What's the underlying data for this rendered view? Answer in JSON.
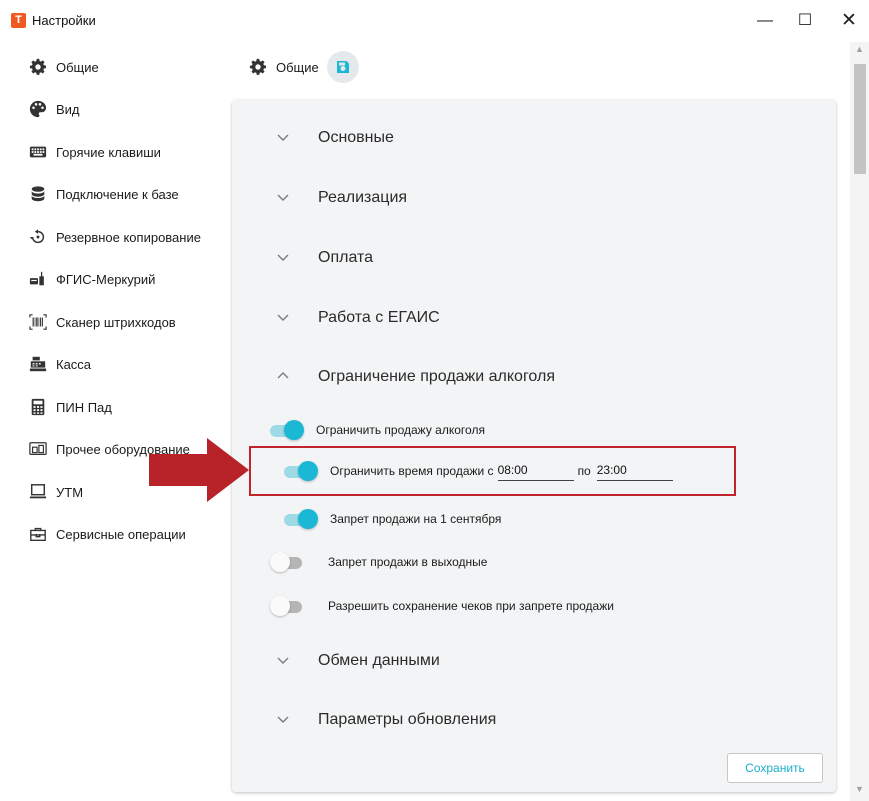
{
  "window": {
    "app_icon": "T",
    "title": "Настройки",
    "minimize": "—",
    "maximize": "☐",
    "close": "✕"
  },
  "sidebar": {
    "items": [
      {
        "label": "Общие",
        "icon": "gear-icon"
      },
      {
        "label": "Вид",
        "icon": "palette-icon"
      },
      {
        "label": "Горячие клавиши",
        "icon": "keyboard-icon"
      },
      {
        "label": "Подключение к базе",
        "icon": "database-icon"
      },
      {
        "label": "Резервное копирование",
        "icon": "backup-icon"
      },
      {
        "label": "ФГИС-Меркурий",
        "icon": "mercury-icon"
      },
      {
        "label": "Сканер штрихкодов",
        "icon": "barcode-icon"
      },
      {
        "label": "Касса",
        "icon": "cash-register-icon"
      },
      {
        "label": "ПИН Пад",
        "icon": "calculator-icon"
      },
      {
        "label": "Прочее оборудование",
        "icon": "devices-icon"
      },
      {
        "label": "УТМ",
        "icon": "monitor-icon"
      },
      {
        "label": "Сервисные операции",
        "icon": "toolbox-icon"
      }
    ]
  },
  "header": {
    "title": "Общие"
  },
  "sections": [
    {
      "label": "Основные",
      "expanded": false
    },
    {
      "label": "Реализация",
      "expanded": false
    },
    {
      "label": "Оплата",
      "expanded": false
    },
    {
      "label": "Работа с ЕГАИС",
      "expanded": false
    },
    {
      "label": "Ограничение продажи алкоголя",
      "expanded": true
    },
    {
      "label": "Обмен данными",
      "expanded": false
    },
    {
      "label": "Параметры обновления",
      "expanded": false
    }
  ],
  "alcohol": {
    "limit_sale": {
      "label": "Ограничить продажу алкоголя",
      "on": true
    },
    "limit_time": {
      "label": "Ограничить время продажи с",
      "on": true,
      "from": "08:00",
      "to_label": "по",
      "to": "23:00"
    },
    "ban_sept1": {
      "label": "Запрет продажи на 1 сентября",
      "on": true
    },
    "ban_weekends": {
      "label": "Запрет продажи в выходные",
      "on": false
    },
    "allow_save_receipts": {
      "label": "Разрешить сохранение чеков при запрете продажи",
      "on": false
    }
  },
  "footer": {
    "save_label": "Сохранить"
  },
  "colors": {
    "accent": "#1ab8d5",
    "highlight": "#c0252b",
    "arrow": "#b8232a"
  }
}
